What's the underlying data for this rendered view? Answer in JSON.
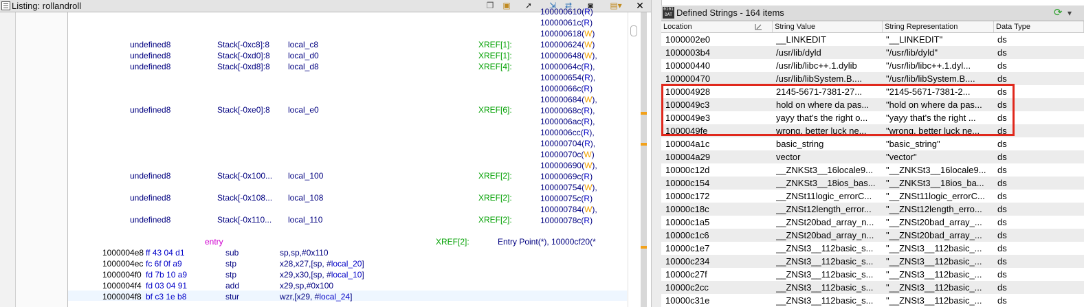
{
  "listing": {
    "title": "Listing:  rollandroll",
    "toolbar_icons": [
      "copy-icon",
      "paste-icon",
      "cursor-icon",
      "navigate-icon",
      "diff-icon",
      "snapshot-icon",
      "layout-icon",
      "close-icon"
    ],
    "close_label": "✕",
    "variables": [
      {
        "type": "undefined8",
        "storage": "Stack[-0xc8]:8",
        "name": "local_c8",
        "xref": "XREF[1]:"
      },
      {
        "type": "undefined8",
        "storage": "Stack[-0xd0]:8",
        "name": "local_d0",
        "xref": "XREF[1]:"
      },
      {
        "type": "undefined8",
        "storage": "Stack[-0xd8]:8",
        "name": "local_d8",
        "xref": "XREF[4]:"
      },
      {
        "type": "undefined8",
        "storage": "Stack[-0xe0]:8",
        "name": "local_e0",
        "xref": "XREF[6]:"
      },
      {
        "type": "undefined8",
        "storage": "Stack[-0x100...",
        "name": "local_100",
        "xref": "XREF[2]:"
      },
      {
        "type": "undefined8",
        "storage": "Stack[-0x108...",
        "name": "local_108",
        "xref": "XREF[2]:"
      },
      {
        "type": "undefined8",
        "storage": "Stack[-0x110...",
        "name": "local_110",
        "xref": "XREF[2]:"
      }
    ],
    "xref_addrs": [
      {
        "addr": "100000610",
        "rw": "R",
        "tail": ""
      },
      {
        "addr": "10000061c",
        "rw": "R",
        "tail": ""
      },
      {
        "addr": "100000618",
        "rw": "W",
        "tail": ""
      },
      {
        "addr": "100000624",
        "rw": "W",
        "tail": ""
      },
      {
        "addr": "100000648",
        "rw": "W",
        "tail": ","
      },
      {
        "addr": "10000064c",
        "rw": "R",
        "tail": ","
      },
      {
        "addr": "100000654",
        "rw": "R",
        "tail": ","
      },
      {
        "addr": "10000066c",
        "rw": "R",
        "tail": ""
      },
      {
        "addr": "100000684",
        "rw": "W",
        "tail": ","
      },
      {
        "addr": "10000068c",
        "rw": "R",
        "tail": ","
      },
      {
        "addr": "1000006ac",
        "rw": "R",
        "tail": ","
      },
      {
        "addr": "1000006cc",
        "rw": "R",
        "tail": ","
      },
      {
        "addr": "100000704",
        "rw": "R",
        "tail": ","
      },
      {
        "addr": "10000070c",
        "rw": "W",
        "tail": ""
      },
      {
        "addr": "100000690",
        "rw": "W",
        "tail": ","
      },
      {
        "addr": "10000069c",
        "rw": "R",
        "tail": ""
      },
      {
        "addr": "100000754",
        "rw": "W",
        "tail": ","
      },
      {
        "addr": "10000075c",
        "rw": "R",
        "tail": ""
      },
      {
        "addr": "100000784",
        "rw": "W",
        "tail": ","
      },
      {
        "addr": "10000078c",
        "rw": "R",
        "tail": ""
      }
    ],
    "entry_label": "entry",
    "entry_xref": "XREF[2]:",
    "entry_refs": "Entry Point(*), 10000cf20(*",
    "instructions": [
      {
        "addr": "1000004e8",
        "bytes": "ff 43 04 d1",
        "mnemonic": "sub",
        "ops_pre": "sp,sp,#0x110",
        "ops_ref": "",
        "ops_post": ""
      },
      {
        "addr": "1000004ec",
        "bytes": "fc 6f 0f a9",
        "mnemonic": "stp",
        "ops_pre": "x28,x27,[sp, #",
        "ops_ref": "local_20",
        "ops_post": "]"
      },
      {
        "addr": "1000004f0",
        "bytes": "fd 7b 10 a9",
        "mnemonic": "stp",
        "ops_pre": "x29,x30,[sp, #",
        "ops_ref": "local_10",
        "ops_post": "]"
      },
      {
        "addr": "1000004f4",
        "bytes": "fd 03 04 91",
        "mnemonic": "add",
        "ops_pre": "x29,sp,#0x100",
        "ops_ref": "",
        "ops_post": ""
      },
      {
        "addr": "1000004f8",
        "bytes": "bf c3 1e b8",
        "mnemonic": "stur",
        "ops_pre": "wzr,[x29, #",
        "ops_ref": "local_24",
        "ops_post": "]"
      }
    ]
  },
  "strings": {
    "title": "Defined Strings - 164 items",
    "icon_label": "0101 DAT",
    "columns": [
      "Location",
      "String Value",
      "String Representation",
      "Data Type"
    ],
    "rows": [
      {
        "loc": "1000002e0",
        "val": "__LINKEDIT",
        "rep": "\"__LINKEDIT\"",
        "type": "ds"
      },
      {
        "loc": "1000003b4",
        "val": "/usr/lib/dyld",
        "rep": "\"/usr/lib/dyld\"",
        "type": "ds"
      },
      {
        "loc": "100000440",
        "val": "/usr/lib/libc++.1.dylib",
        "rep": "\"/usr/lib/libc++.1.dyl...",
        "type": "ds"
      },
      {
        "loc": "100000470",
        "val": "/usr/lib/libSystem.B....",
        "rep": "\"/usr/lib/libSystem.B....",
        "type": "ds"
      },
      {
        "loc": "100004928",
        "val": "2145-5671-7381-27...",
        "rep": "\"2145-5671-7381-2...",
        "type": "ds"
      },
      {
        "loc": "1000049c3",
        "val": "hold on where da pas...",
        "rep": "\"hold on where da pas...",
        "type": "ds"
      },
      {
        "loc": "1000049e3",
        "val": "yayy that's the right o...",
        "rep": "\"yayy that's the right ...",
        "type": "ds"
      },
      {
        "loc": "1000049fe",
        "val": "wrong, better luck ne...",
        "rep": "\"wrong, better luck ne...",
        "type": "ds"
      },
      {
        "loc": "100004a1c",
        "val": "basic_string",
        "rep": "\"basic_string\"",
        "type": "ds"
      },
      {
        "loc": "100004a29",
        "val": "vector",
        "rep": "\"vector\"",
        "type": "ds"
      },
      {
        "loc": "10000c12d",
        "val": "__ZNKSt3__16locale9...",
        "rep": "\"__ZNKSt3__16locale9...",
        "type": "ds"
      },
      {
        "loc": "10000c154",
        "val": "__ZNKSt3__18ios_bas...",
        "rep": "\"__ZNKSt3__18ios_ba...",
        "type": "ds"
      },
      {
        "loc": "10000c172",
        "val": "__ZNSt11logic_errorC...",
        "rep": "\"__ZNSt11logic_errorC...",
        "type": "ds"
      },
      {
        "loc": "10000c18c",
        "val": "__ZNSt12length_error...",
        "rep": "\"__ZNSt12length_erro...",
        "type": "ds"
      },
      {
        "loc": "10000c1a5",
        "val": "__ZNSt20bad_array_n...",
        "rep": "\"__ZNSt20bad_array_...",
        "type": "ds"
      },
      {
        "loc": "10000c1c6",
        "val": "__ZNSt20bad_array_n...",
        "rep": "\"__ZNSt20bad_array_...",
        "type": "ds"
      },
      {
        "loc": "10000c1e7",
        "val": "__ZNSt3__112basic_s...",
        "rep": "\"__ZNSt3__112basic_...",
        "type": "ds"
      },
      {
        "loc": "10000c234",
        "val": "__ZNSt3__112basic_s...",
        "rep": "\"__ZNSt3__112basic_...",
        "type": "ds"
      },
      {
        "loc": "10000c27f",
        "val": "__ZNSt3__112basic_s...",
        "rep": "\"__ZNSt3__112basic_...",
        "type": "ds"
      },
      {
        "loc": "10000c2cc",
        "val": "__ZNSt3__112basic_s...",
        "rep": "\"__ZNSt3__112basic_...",
        "type": "ds"
      },
      {
        "loc": "10000c31e",
        "val": "__ZNSt3__112basic_s...",
        "rep": "\"__ZNSt3__112basic_...",
        "type": "ds"
      }
    ],
    "highlighted_rows": [
      4,
      5,
      6,
      7
    ]
  },
  "colors": {
    "highlight_border": "#e0281c",
    "xref_green": "#00a000",
    "read_blue": "#0000c8",
    "write_orange": "#f0a000",
    "entry_magenta": "#d000d0"
  }
}
